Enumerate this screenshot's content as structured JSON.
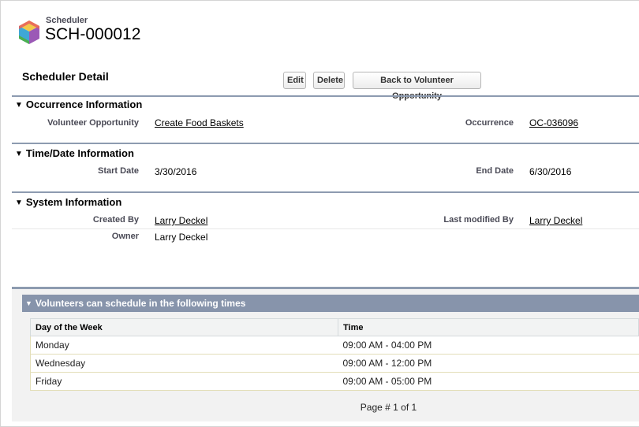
{
  "header": {
    "object_type": "Scheduler",
    "record_name": "SCH-000012",
    "logo_icon": "cube-icon"
  },
  "detail": {
    "title": "Scheduler Detail",
    "buttons": {
      "edit": "Edit",
      "delete": "Delete",
      "back": "Back to Volunteer Opportunity"
    }
  },
  "sections": {
    "occurrence": {
      "title": "Occurrence Information",
      "volunteer_opportunity_label": "Volunteer Opportunity",
      "volunteer_opportunity_value": "Create Food Baskets",
      "occurrence_label": "Occurrence",
      "occurrence_value": "OC-036096"
    },
    "time_date": {
      "title": "Time/Date Information",
      "start_date_label": "Start Date",
      "start_date_value": "3/30/2016",
      "end_date_label": "End Date",
      "end_date_value": "6/30/2016"
    },
    "system": {
      "title": "System Information",
      "created_by_label": "Created By",
      "created_by_value": "Larry Deckel",
      "last_modified_label": "Last modified By",
      "last_modified_value": "Larry Deckel",
      "owner_label": "Owner",
      "owner_value": "Larry Deckel"
    }
  },
  "related": {
    "title": "Volunteers can schedule in the following times",
    "columns": [
      "Day of the Week",
      "Time"
    ],
    "rows": [
      [
        "Monday",
        "09:00 AM - 04:00 PM"
      ],
      [
        "Wednesday",
        "09:00 AM - 12:00 PM"
      ],
      [
        "Friday",
        "09:00 AM - 05:00 PM"
      ]
    ],
    "pager": "Page # 1 of 1"
  },
  "colors": {
    "section_rule": "#8d9bb0",
    "related_header": "#8794ab"
  }
}
